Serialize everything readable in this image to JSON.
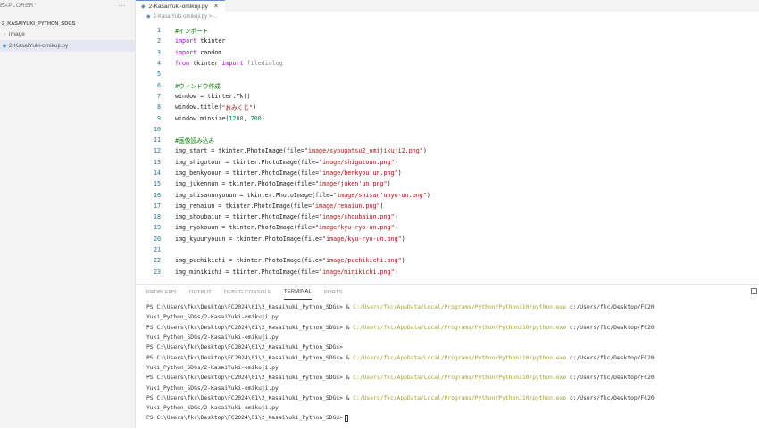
{
  "sidebar": {
    "title": "EXPLORER",
    "more": "···",
    "root": "2_KASAIYUKI_PYTHON_SDGS",
    "items": [
      {
        "chev": "›",
        "label": "image"
      },
      {
        "chev": "◆",
        "label": "2-KasaiYuki-omikuji.py"
      }
    ]
  },
  "editor": {
    "tab": {
      "icon": "◆",
      "label": "2-KasaiYuki-omikuji.py",
      "close": "✕"
    },
    "breadcrumb": {
      "icon": "◆",
      "text": "2-KasaiYuki-omikuji.py > ..."
    },
    "lines": [
      {
        "n": "1",
        "segs": [
          {
            "c": "cmt",
            "t": "#インポート"
          }
        ]
      },
      {
        "n": "2",
        "segs": [
          {
            "c": "kw",
            "t": "import"
          },
          {
            "c": "src",
            "t": " tkinter"
          }
        ]
      },
      {
        "n": "3",
        "segs": [
          {
            "c": "kw",
            "t": "import"
          },
          {
            "c": "src",
            "t": " random"
          }
        ]
      },
      {
        "n": "4",
        "segs": [
          {
            "c": "kw",
            "t": "from"
          },
          {
            "c": "src",
            "t": " tkinter "
          },
          {
            "c": "kw",
            "t": "import"
          },
          {
            "c": "dim",
            "t": " filedialog"
          }
        ]
      },
      {
        "n": "5",
        "segs": []
      },
      {
        "n": "6",
        "segs": [
          {
            "c": "cmt",
            "t": "#ウィンドウ作成"
          }
        ]
      },
      {
        "n": "7",
        "segs": [
          {
            "c": "src",
            "t": "window = tkinter.Tk()"
          }
        ]
      },
      {
        "n": "8",
        "segs": [
          {
            "c": "src",
            "t": "window.title("
          },
          {
            "c": "str",
            "t": "\"おみくじ\""
          },
          {
            "c": "src",
            "t": ")"
          }
        ]
      },
      {
        "n": "9",
        "segs": [
          {
            "c": "src",
            "t": "window.minsize("
          },
          {
            "c": "num",
            "t": "1200"
          },
          {
            "c": "src",
            "t": ", "
          },
          {
            "c": "num",
            "t": "700"
          },
          {
            "c": "src",
            "t": ")"
          }
        ]
      },
      {
        "n": "10",
        "segs": []
      },
      {
        "n": "11",
        "segs": [
          {
            "c": "cmt",
            "t": "#画像読み込み"
          }
        ]
      },
      {
        "n": "12",
        "segs": [
          {
            "c": "src",
            "t": "img_start = tkinter.PhotoImage(file="
          },
          {
            "c": "str",
            "t": "\"image/syougatsu2_omijikuji2.png\""
          },
          {
            "c": "src",
            "t": ")"
          }
        ]
      },
      {
        "n": "13",
        "segs": [
          {
            "c": "src",
            "t": "img_shigotoun = tkinter.PhotoImage(file="
          },
          {
            "c": "str",
            "t": "\"image/shigotoun.png\""
          },
          {
            "c": "src",
            "t": ")"
          }
        ]
      },
      {
        "n": "14",
        "segs": [
          {
            "c": "src",
            "t": "img_benkyouun = tkinter.PhotoImage(file="
          },
          {
            "c": "str",
            "t": "\"image/benkyou'un.png\""
          },
          {
            "c": "src",
            "t": ")"
          }
        ]
      },
      {
        "n": "15",
        "segs": [
          {
            "c": "src",
            "t": "img_jukennun = tkinter.PhotoImage(file="
          },
          {
            "c": "str",
            "t": "\"image/juken'un.png\""
          },
          {
            "c": "src",
            "t": ")"
          }
        ]
      },
      {
        "n": "16",
        "segs": [
          {
            "c": "src",
            "t": "img_shisanunyouun = tkinter.PhotoImage(file="
          },
          {
            "c": "str",
            "t": "\"image/shisan'unyo-un.png\""
          },
          {
            "c": "src",
            "t": ")"
          }
        ]
      },
      {
        "n": "17",
        "segs": [
          {
            "c": "src",
            "t": "img_renaiun = tkinter.PhotoImage(file="
          },
          {
            "c": "str",
            "t": "\"image/renaiun.png\""
          },
          {
            "c": "src",
            "t": ")"
          }
        ]
      },
      {
        "n": "18",
        "segs": [
          {
            "c": "src",
            "t": "img_shoubaiun = tkinter.PhotoImage(file="
          },
          {
            "c": "str",
            "t": "\"image/shoubaiun.png\""
          },
          {
            "c": "src",
            "t": ")"
          }
        ]
      },
      {
        "n": "19",
        "segs": [
          {
            "c": "src",
            "t": "img_ryokouun = tkinter.PhotoImage(file="
          },
          {
            "c": "str",
            "t": "\"image/kyu-ryo-un.png\""
          },
          {
            "c": "src",
            "t": ")"
          }
        ]
      },
      {
        "n": "20",
        "segs": [
          {
            "c": "src",
            "t": "img_kyuuryouun = tkinter.PhotoImage(file="
          },
          {
            "c": "str",
            "t": "\"image/kyu-ryo-un.png\""
          },
          {
            "c": "src",
            "t": ")"
          }
        ]
      },
      {
        "n": "21",
        "segs": []
      },
      {
        "n": "22",
        "segs": [
          {
            "c": "src",
            "t": "img_puchikichi = tkinter.PhotoImage(file="
          },
          {
            "c": "str",
            "t": "\"image/puchikichi.png\""
          },
          {
            "c": "src",
            "t": ")"
          }
        ]
      },
      {
        "n": "23",
        "segs": [
          {
            "c": "src",
            "t": "img_minikichi = tkinter.PhotoImage(file="
          },
          {
            "c": "str",
            "t": "\"image/minikichi.png\""
          },
          {
            "c": "src",
            "t": ")"
          }
        ]
      }
    ]
  },
  "panel": {
    "tabs": [
      "PROBLEMS",
      "OUTPUT",
      "DEBUG CONSOLE",
      "TERMINAL",
      "PORTS"
    ],
    "active_tab": "TERMINAL",
    "terminal_lines": [
      {
        "a": "PS C:\\Users\\fkc\\Desktop\\FC2024\\01\\2_KasaiYuki_Python_SDGs> & ",
        "p": "C:/Users/fkc/AppData/Local/Programs/Python/Python310/python.exe",
        "b": " c:/Users/fkc/Desktop/FC20"
      },
      {
        "a": "Yuki_Python_SDGs/2-KasaiYuki-omikuji.py",
        "p": "",
        "b": ""
      },
      {
        "a": "PS C:\\Users\\fkc\\Desktop\\FC2024\\01\\2_KasaiYuki_Python_SDGs> & ",
        "p": "C:/Users/fkc/AppData/Local/Programs/Python/Python310/python.exe",
        "b": " c:/Users/fkc/Desktop/FC20"
      },
      {
        "a": "Yuki_Python_SDGs/2-KasaiYuki-omikuji.py",
        "p": "",
        "b": ""
      },
      {
        "a": "PS C:\\Users\\fkc\\Desktop\\FC2024\\01\\2_KasaiYuki_Python_SDGs>",
        "p": "",
        "b": ""
      },
      {
        "a": "PS C:\\Users\\fkc\\Desktop\\FC2024\\01\\2_KasaiYuki_Python_SDGs> & ",
        "p": "C:/Users/fkc/AppData/Local/Programs/Python/Python310/python.exe",
        "b": " c:/Users/fkc/Desktop/FC20"
      },
      {
        "a": "Yuki_Python_SDGs/2-KasaiYuki-omikuji.py",
        "p": "",
        "b": ""
      },
      {
        "a": "PS C:\\Users\\fkc\\Desktop\\FC2024\\01\\2_KasaiYuki_Python_SDGs> & ",
        "p": "C:/Users/fkc/AppData/Local/Programs/Python/Python310/python.exe",
        "b": " c:/Users/fkc/Desktop/FC20"
      },
      {
        "a": "Yuki_Python_SDGs/2-KasaiYuki-omikuji.py",
        "p": "",
        "b": ""
      },
      {
        "a": "PS C:\\Users\\fkc\\Desktop\\FC2024\\01\\2_KasaiYuki_Python_SDGs> & ",
        "p": "C:/Users/fkc/AppData/Local/Programs/Python/Python310/python.exe",
        "b": " c:/Users/fkc/Desktop/FC20"
      },
      {
        "a": "Yuki_Python_SDGs/2-KasaiYuki-omikuji.py",
        "p": "",
        "b": ""
      },
      {
        "a": "PS C:\\Users\\fkc\\Desktop\\FC2024\\01\\2_KasaiYuki_Python_SDGs>",
        "p": "",
        "b": ""
      }
    ]
  },
  "colors": {
    "accent": "#5b8ec9",
    "terminal_path": "#a1a32b",
    "line_number": "#237893"
  }
}
